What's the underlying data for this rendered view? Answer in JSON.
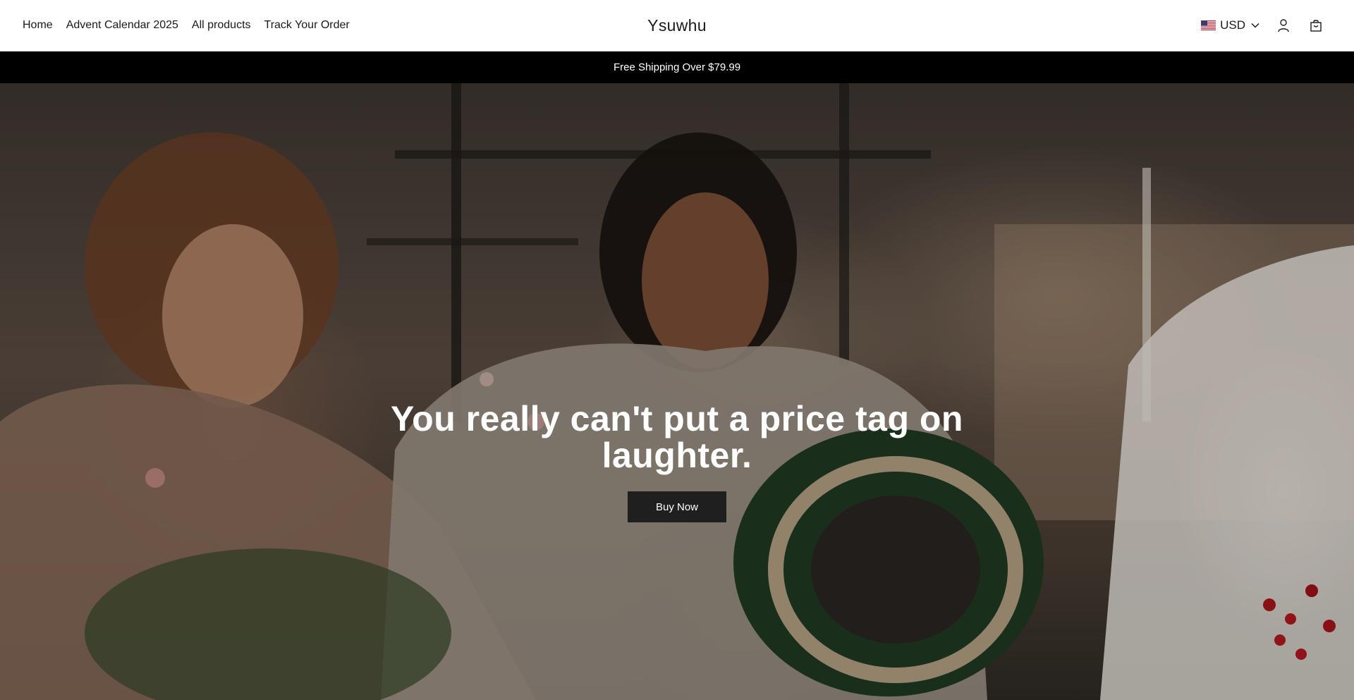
{
  "header": {
    "nav": [
      {
        "label": "Home"
      },
      {
        "label": "Advent Calendar 2025"
      },
      {
        "label": "All products"
      },
      {
        "label": "Track Your Order"
      }
    ],
    "logo": "Ysuwhu",
    "currency": {
      "label": "USD",
      "flag_icon": "us-flag-icon"
    },
    "icons": [
      "account-icon",
      "cart-icon"
    ]
  },
  "announcement": {
    "text": "Free Shipping Over $79.99"
  },
  "hero": {
    "title": "You really can't put a price tag on laughter.",
    "button_label": "Buy Now"
  },
  "colors": {
    "announcement_bg": "#000000",
    "button_bg": "#1f1f1f",
    "text": "#1a1a1a"
  }
}
